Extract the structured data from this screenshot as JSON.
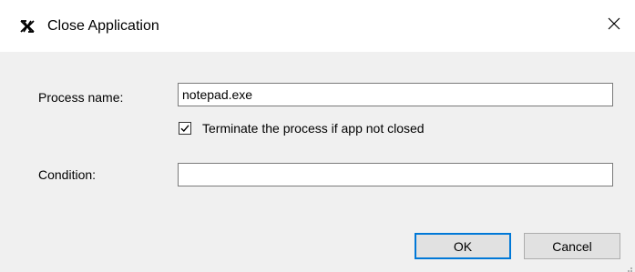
{
  "window": {
    "title": "Close Application",
    "app_icon": "close-application-icon",
    "close_icon": "close-icon"
  },
  "form": {
    "process_name_label": "Process name:",
    "process_name_value": "notepad.exe",
    "terminate_checkbox_label": "Terminate the process if app not closed",
    "terminate_checked": true,
    "condition_label": "Condition:",
    "condition_value": ""
  },
  "buttons": {
    "ok_label": "OK",
    "cancel_label": "Cancel"
  },
  "colors": {
    "dialog_background": "#f0f0f0",
    "titlebar_background": "#ffffff",
    "default_button_border": "#0078d7"
  }
}
